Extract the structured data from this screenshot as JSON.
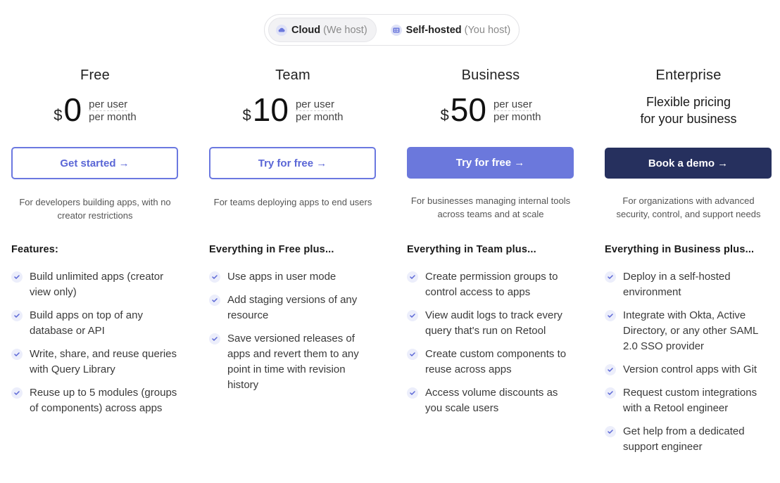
{
  "hosting_toggle": {
    "options": [
      {
        "label": "Cloud",
        "note": "(We host)",
        "icon": "cloud-icon",
        "active": true
      },
      {
        "label": "Self-hosted",
        "note": "(You host)",
        "icon": "server-icon",
        "active": false
      }
    ]
  },
  "colors": {
    "accent": "#6b78dc",
    "accent_text": "#5a66d6",
    "dark": "#26305e",
    "check_bg": "#eceefb",
    "check_mark": "#5a66d6"
  },
  "plans": [
    {
      "name": "Free",
      "currency": "$",
      "price": "0",
      "unit_line1": "per user",
      "unit_line2": "per month",
      "cta": "Get started →",
      "description": "For developers building apps, with no creator restrictions",
      "features_heading": "Features:",
      "features": [
        "Build unlimited apps (creator view only)",
        "Build apps on top of any database or API",
        "Write, share, and reuse queries with Query Library",
        "Reuse up to 5 modules (groups of components) across apps"
      ]
    },
    {
      "name": "Team",
      "currency": "$",
      "price": "10",
      "unit_line1": "per user",
      "unit_line2": "per month",
      "cta": "Try for free →",
      "description": "For teams deploying apps to end users",
      "features_heading": "Everything in Free plus...",
      "features": [
        "Use apps in user mode",
        "Add staging versions of any resource",
        "Save versioned releases of apps and revert them to any point in time with revision history"
      ]
    },
    {
      "name": "Business",
      "currency": "$",
      "price": "50",
      "unit_line1": "per user",
      "unit_line2": "per month",
      "cta": "Try for free →",
      "description": "For businesses managing internal tools across teams and at scale",
      "features_heading": "Everything in Team plus...",
      "features": [
        "Create permission groups to control access to apps",
        "View audit logs to track every query that's run on Retool",
        "Create custom components to reuse across apps",
        "Access volume discounts as you scale users"
      ]
    },
    {
      "name": "Enterprise",
      "price_line1": "Flexible pricing",
      "price_line2": "for your business",
      "cta": "Book a demo →",
      "description": "For organizations with advanced security, control, and support needs",
      "features_heading": "Everything in Business plus...",
      "features": [
        "Deploy in a self-hosted environment",
        "Integrate with Okta, Active Directory, or any other SAML 2.0 SSO provider",
        "Version control apps with Git",
        "Request custom integrations with a Retool engineer",
        "Get help from a dedicated support engineer"
      ]
    }
  ]
}
